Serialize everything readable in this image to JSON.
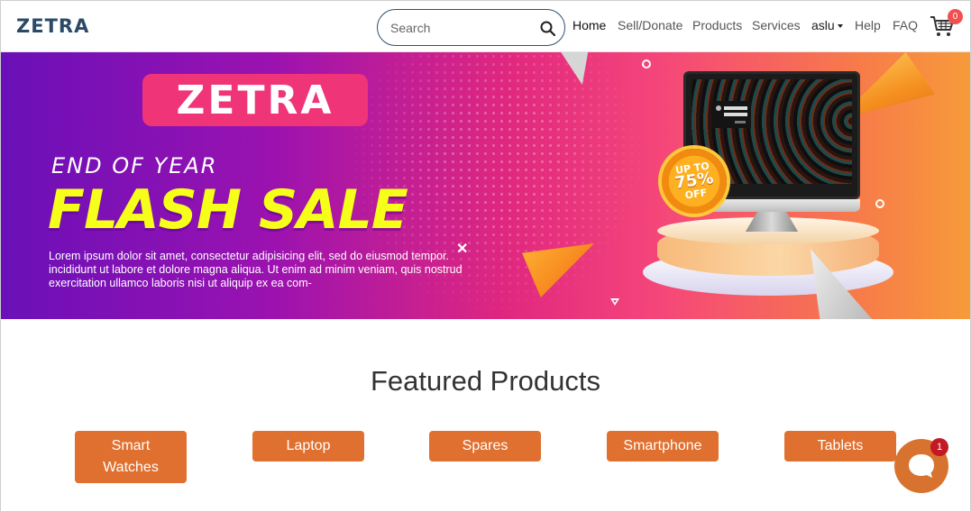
{
  "navbar": {
    "logo": "ZETRA",
    "search": {
      "placeholder": "Search",
      "value": ""
    },
    "links": [
      "Home",
      "Sell/Donate",
      "Products",
      "Services",
      "aslu",
      "Help",
      "FAQ"
    ],
    "cart_count": "0"
  },
  "hero": {
    "brand": "ZETRA",
    "kicker": "END OF YEAR",
    "title": "FLASH SALE",
    "body": "Lorem ipsum dolor sit amet, consectetur adipisicing elit, sed do eiusmod tempor. incididunt ut labore et dolore magna aliqua. Ut enim ad minim veniam, quis nostrud exercitation ullamco laboris nisi ut aliquip ex ea com-",
    "seal": {
      "line1": "UP TO",
      "line2": "75%",
      "line3": "OFF"
    }
  },
  "featured": {
    "title": "Featured Products",
    "categories": [
      "Smart Watches",
      "Laptop",
      "Spares",
      "Smartphone",
      "Tablets"
    ]
  },
  "chat": {
    "badge": "1"
  },
  "colors": {
    "logo": "#2a4a67",
    "accent_orange": "#e07030",
    "hero_brand_pink": "#ef3577",
    "hero_title_yellow": "#f6ff1a",
    "badge_red": "#f05050"
  }
}
